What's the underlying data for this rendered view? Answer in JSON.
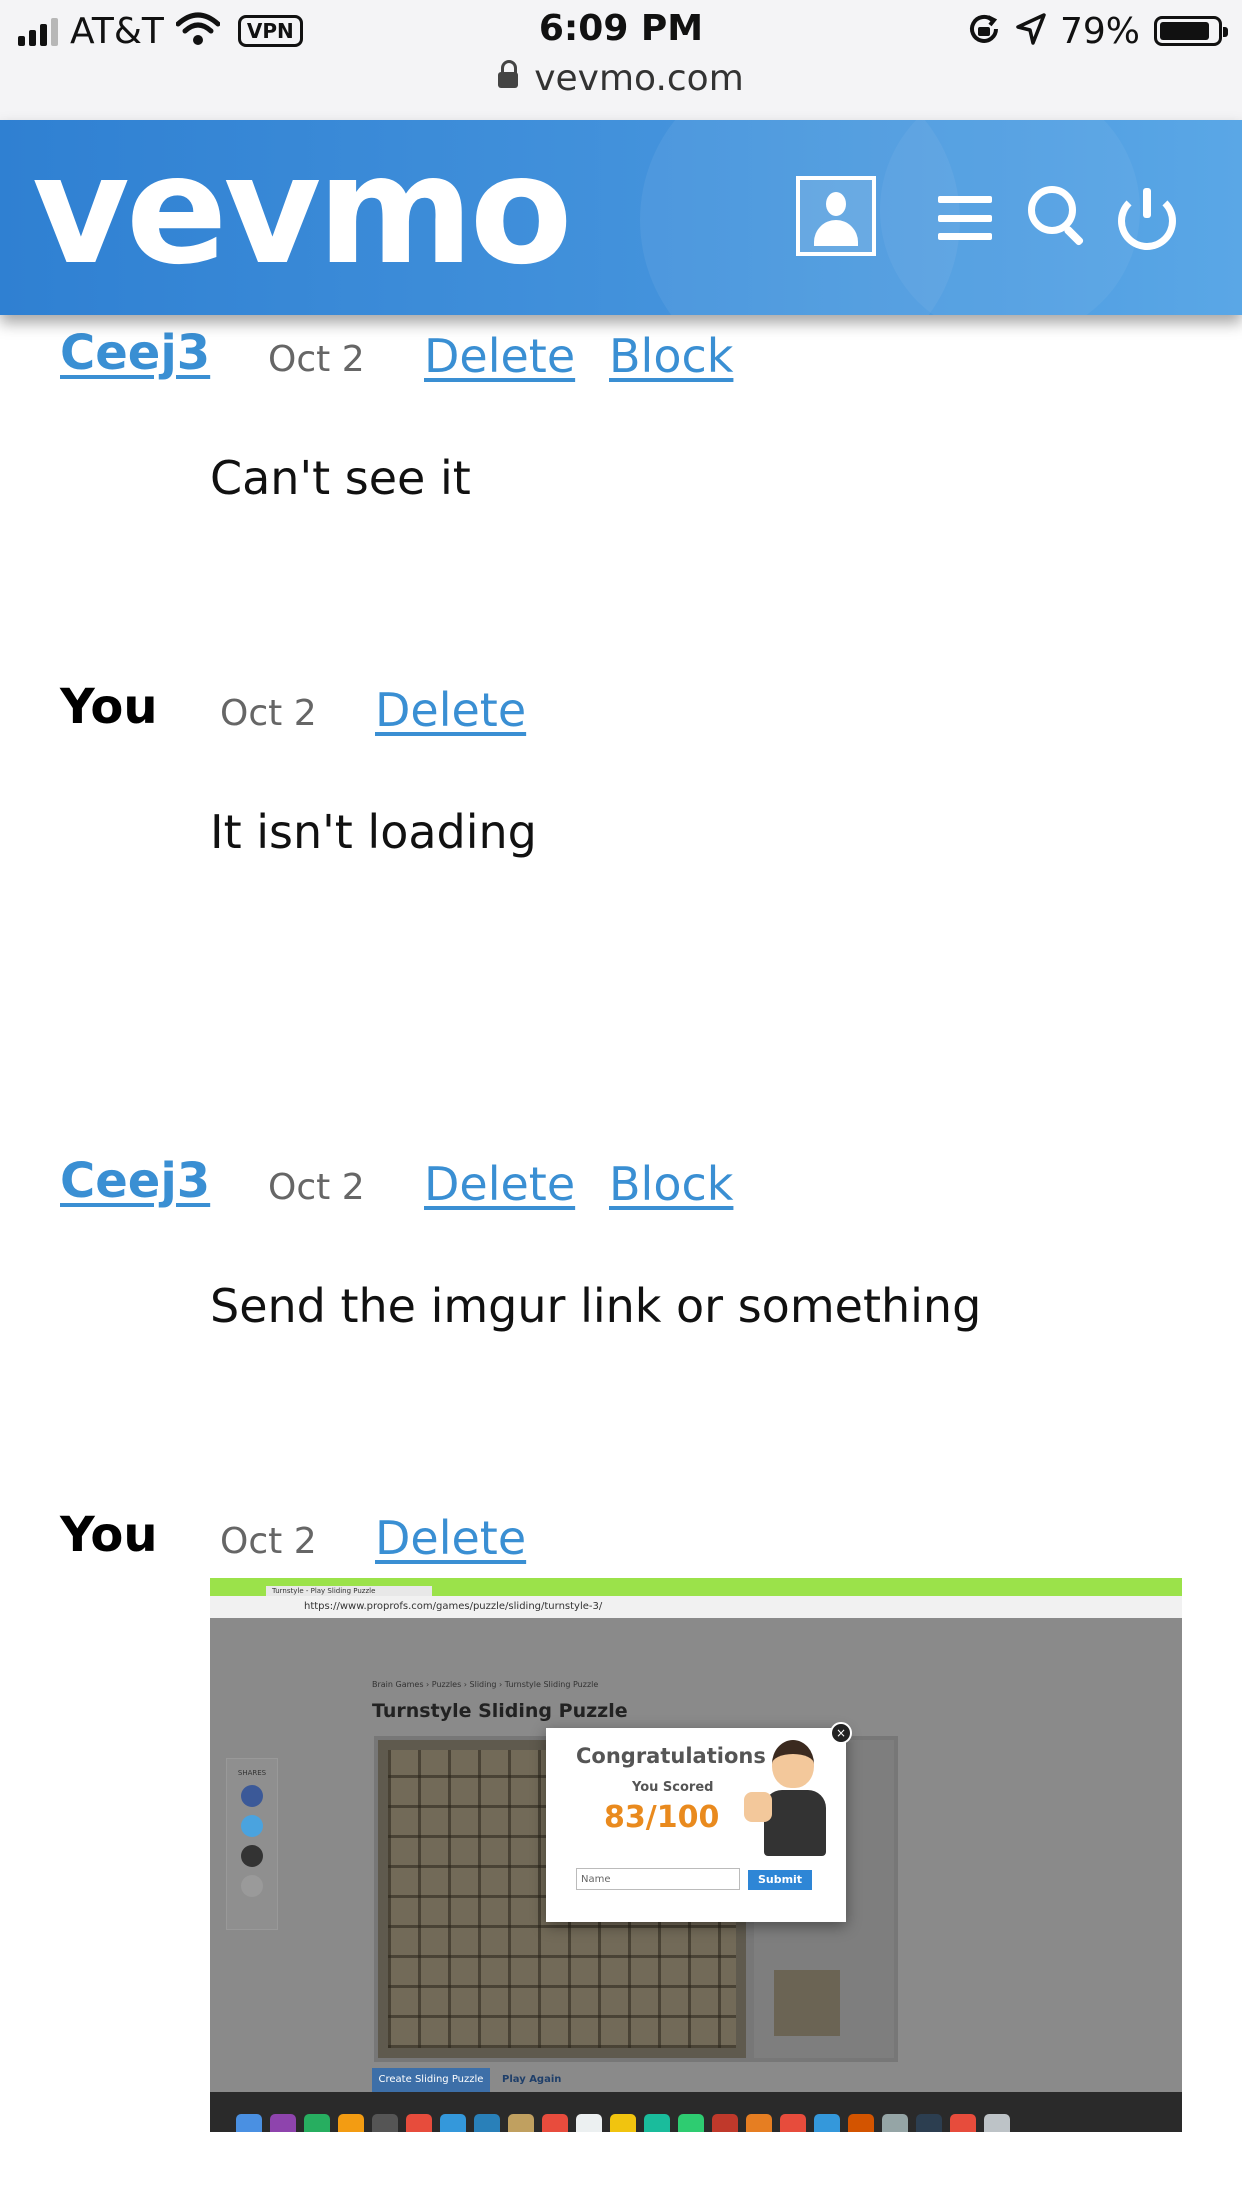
{
  "status_bar": {
    "carrier": "AT&T",
    "vpn": "VPN",
    "time": "6:09 PM",
    "battery": "79%",
    "url": "vevmo.com"
  },
  "header": {
    "logo": "vevmo",
    "icons": [
      "profile-icon",
      "menu-icon",
      "search-icon",
      "power-icon"
    ]
  },
  "colors": {
    "header_blue": "#3b8bd8",
    "link_blue": "#3a8fd3"
  },
  "messages": [
    {
      "author": "Ceej3",
      "date": "Oct 2",
      "delete": "Delete",
      "block": "Block",
      "text": "Can't see it"
    },
    {
      "author": "You",
      "date": "Oct 2",
      "delete": "Delete",
      "text": "It isn't loading"
    },
    {
      "author": "Ceej3",
      "date": "Oct 2",
      "delete": "Delete",
      "block": "Block",
      "text": "Send the imgur link or something"
    },
    {
      "author": "You",
      "date": "Oct 2",
      "delete": "Delete"
    }
  ],
  "attachment": {
    "tab": "Turnstyle - Play Sliding Puzzle",
    "address": "https://www.proprofs.com/games/puzzle/sliding/turnstyle-3/",
    "breadcrumb": "Brain Games › Puzzles › Sliding › Turnstyle Sliding Puzzle",
    "page_title": "Turnstyle Sliding Puzzle",
    "shares_label": "SHARES",
    "popup_title": "Congratulations",
    "popup_scored": "You Scored",
    "popup_score": "83/100",
    "name_placeholder": "Name",
    "submit": "Submit",
    "create_button": "Create Sliding Puzzle",
    "play_again": "Play Again"
  }
}
